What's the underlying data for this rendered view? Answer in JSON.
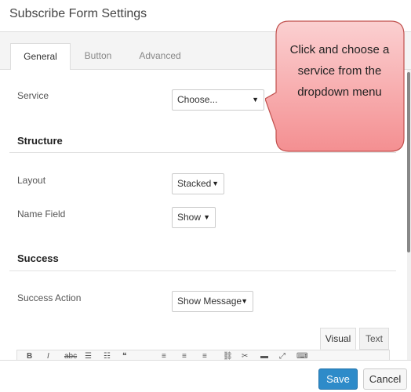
{
  "window": {
    "title": "Subscribe Form Settings"
  },
  "tabs": [
    {
      "label": "General",
      "active": true
    },
    {
      "label": "Button",
      "active": false
    },
    {
      "label": "Advanced",
      "active": false
    }
  ],
  "fields": {
    "service": {
      "label": "Service",
      "value": "Choose..."
    },
    "layout": {
      "label": "Layout",
      "value": "Stacked"
    },
    "name_field": {
      "label": "Name Field",
      "value": "Show"
    },
    "success_action": {
      "label": "Success Action",
      "value": "Show Message"
    }
  },
  "sections": {
    "structure": "Structure",
    "success": "Success"
  },
  "editor": {
    "tabs": [
      {
        "label": "Visual",
        "active": true
      },
      {
        "label": "Text",
        "active": false
      }
    ]
  },
  "footer": {
    "save_label": "Save",
    "cancel_label": "Cancel"
  },
  "callout": {
    "text": "Click and choose a service from the dropdown menu"
  },
  "colors": {
    "accent": "#2e8bc9",
    "callout_fill": "#f7a2a4",
    "callout_stroke": "#c0504d"
  }
}
